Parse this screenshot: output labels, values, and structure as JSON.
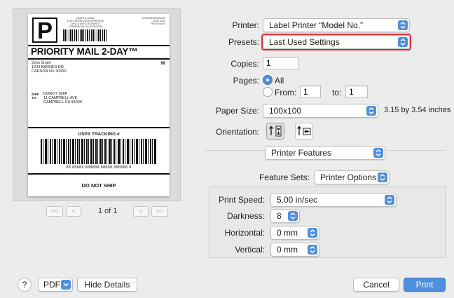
{
  "label_preview": {
    "big_letter": "P",
    "header_fine_print": [
      "SAMPLE LABEL",
      "ELECTRONIC RATE APPROVED",
      "CHECK AND DISCHARGE",
      "COMMERCIAL PLUS PRICING"
    ],
    "permit_fine_print": [
      "00000000000000000",
      "JUNE 2023",
      "FROM 00000"
    ],
    "service_title": "PRIORITY MAIL 2-DAY™",
    "sender_lines": "John Smith\n1234 BARNES RD\nCARSON NV 30000",
    "zone_code": "99",
    "ship_to_tag": "SHIP\nTO:",
    "recipient_lines": "DONOT SHIP\n11 CAMPBELL AVE\nCAMPBELL CA 95009",
    "tracking_heading": "USPS TRACKING #",
    "tracking_digits": "88 88888 888888 88888 888888 8",
    "footer": "DO NOT SHIP"
  },
  "pager": {
    "first": "<<",
    "prev": "<",
    "page_text": "1 of 1",
    "next": ">",
    "last": ">>"
  },
  "printer": {
    "label": "Printer:",
    "value": "Label Printer  “Model No.”"
  },
  "presets": {
    "label": "Presets:",
    "value": "Last Used Settings"
  },
  "copies": {
    "label": "Copies:",
    "value": "1"
  },
  "pages": {
    "label": "Pages:",
    "all_label": "All",
    "from_label": "From:",
    "from_value": "1",
    "to_label": "to:",
    "to_value": "1",
    "selected": "all"
  },
  "paper_size": {
    "label": "Paper Size:",
    "value": "100x100",
    "dimensions": "3.15 by 3.54 inches"
  },
  "orientation": {
    "label": "Orientation:",
    "selected": "portrait"
  },
  "section_popup": {
    "value": "Printer Features"
  },
  "feature_sets": {
    "label": "Feature Sets:",
    "value": "Printer Options"
  },
  "print_speed": {
    "label": "Print Speed:",
    "value": "5.00 in/sec"
  },
  "darkness": {
    "label": "Darkness:",
    "value": "8"
  },
  "horizontal": {
    "label": "Horizontal:",
    "value": "0 mm"
  },
  "vertical": {
    "label": "Vertical:",
    "value": "0 mm"
  },
  "footer": {
    "help": "?",
    "pdf": "PDF",
    "hide_details": "Hide Details",
    "cancel": "Cancel",
    "print": "Print"
  },
  "colors": {
    "accent": "#4f8fdc",
    "highlight_ring": "#d9363e",
    "dialog_bg": "#ececec"
  }
}
